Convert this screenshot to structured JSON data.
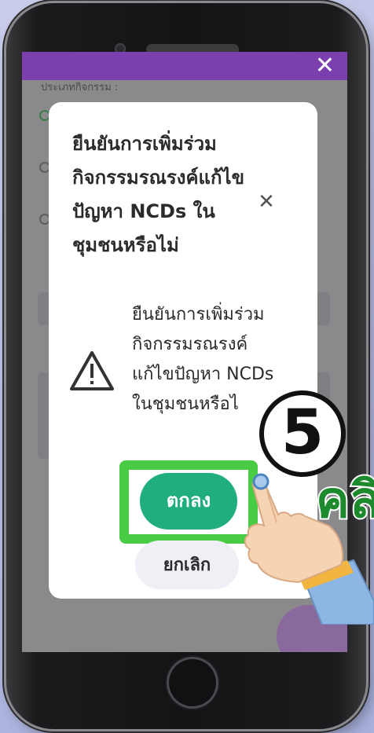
{
  "background_screen": {
    "header_color": "#7b3fb0",
    "close_icon": "close-icon",
    "activity_type_label": "ประเภทกิจกรรม :"
  },
  "dialog": {
    "title": "ยืนยันการเพิ่มร่วมกิจกรรมรณรงค์แก้ไขปัญหา NCDs ในชุมชนหรือไม่",
    "close_icon": "close-icon",
    "warning_icon": "warning-triangle-icon",
    "message": "ยืนยันการเพิ่มร่วมกิจกรรมรณรงค์แก้ไขปัญหา NCDs ในชุมชนหรือไ",
    "ok_label": "ตกลง",
    "cancel_label": "ยกเลิก",
    "ok_color": "#1fae7c"
  },
  "tutorial": {
    "step_number": "5",
    "side_label": "คลิ",
    "highlight_color": "#48cc44",
    "hand_icon": "pointing-hand-icon"
  }
}
